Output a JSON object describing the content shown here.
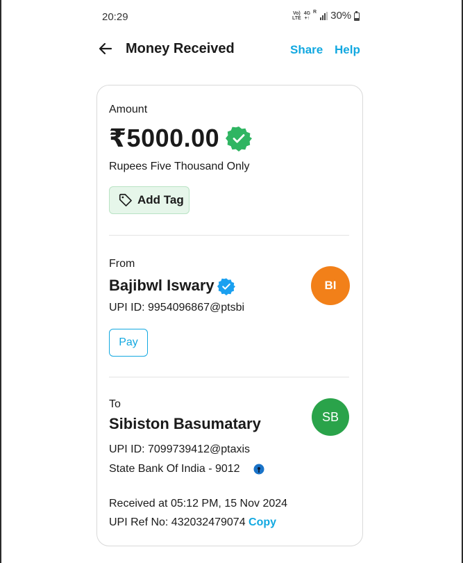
{
  "status_bar": {
    "time": "20:29",
    "net_top": "Vo)",
    "net_bottom": "LTE",
    "net2_top": "4G",
    "net2_bottom": "+↑",
    "sig_label": "R",
    "battery_percent": "30%",
    "battery_level": 0.3
  },
  "header": {
    "title": "Money Received",
    "share_label": "Share",
    "help_label": "Help"
  },
  "amount": {
    "label": "Amount",
    "value": "₹5000.00",
    "words": "Rupees Five Thousand Only",
    "tag_button": "Add Tag"
  },
  "from": {
    "label": "From",
    "name": "Bajibwl Iswary",
    "upi_id": "UPI ID: 9954096867@ptsbi",
    "avatar_initials": "BI",
    "pay_label": "Pay"
  },
  "to": {
    "label": "To",
    "name": "Sibiston Basumatary",
    "upi_id": "UPI ID: 7099739412@ptaxis",
    "bank": "State Bank Of India - 9012",
    "avatar_initials": "SB"
  },
  "details": {
    "received_at": "Received at 05:12 PM, 15 Nov 2024",
    "ref_label": "UPI Ref No: 432032479074",
    "copy_label": "Copy"
  },
  "colors": {
    "accent_blue": "#12a8e0",
    "verified_green": "#2fb562",
    "verified_blue": "#1aa0f0",
    "avatar_orange": "#f28019",
    "avatar_green": "#2aa34a",
    "tag_bg": "#e6f6ea"
  },
  "icons": {
    "back": "arrow-left-icon",
    "amount_verified": "verified-badge-icon",
    "tag": "tag-icon",
    "sender_verified": "verified-badge-icon",
    "bank": "sbi-bank-icon"
  }
}
